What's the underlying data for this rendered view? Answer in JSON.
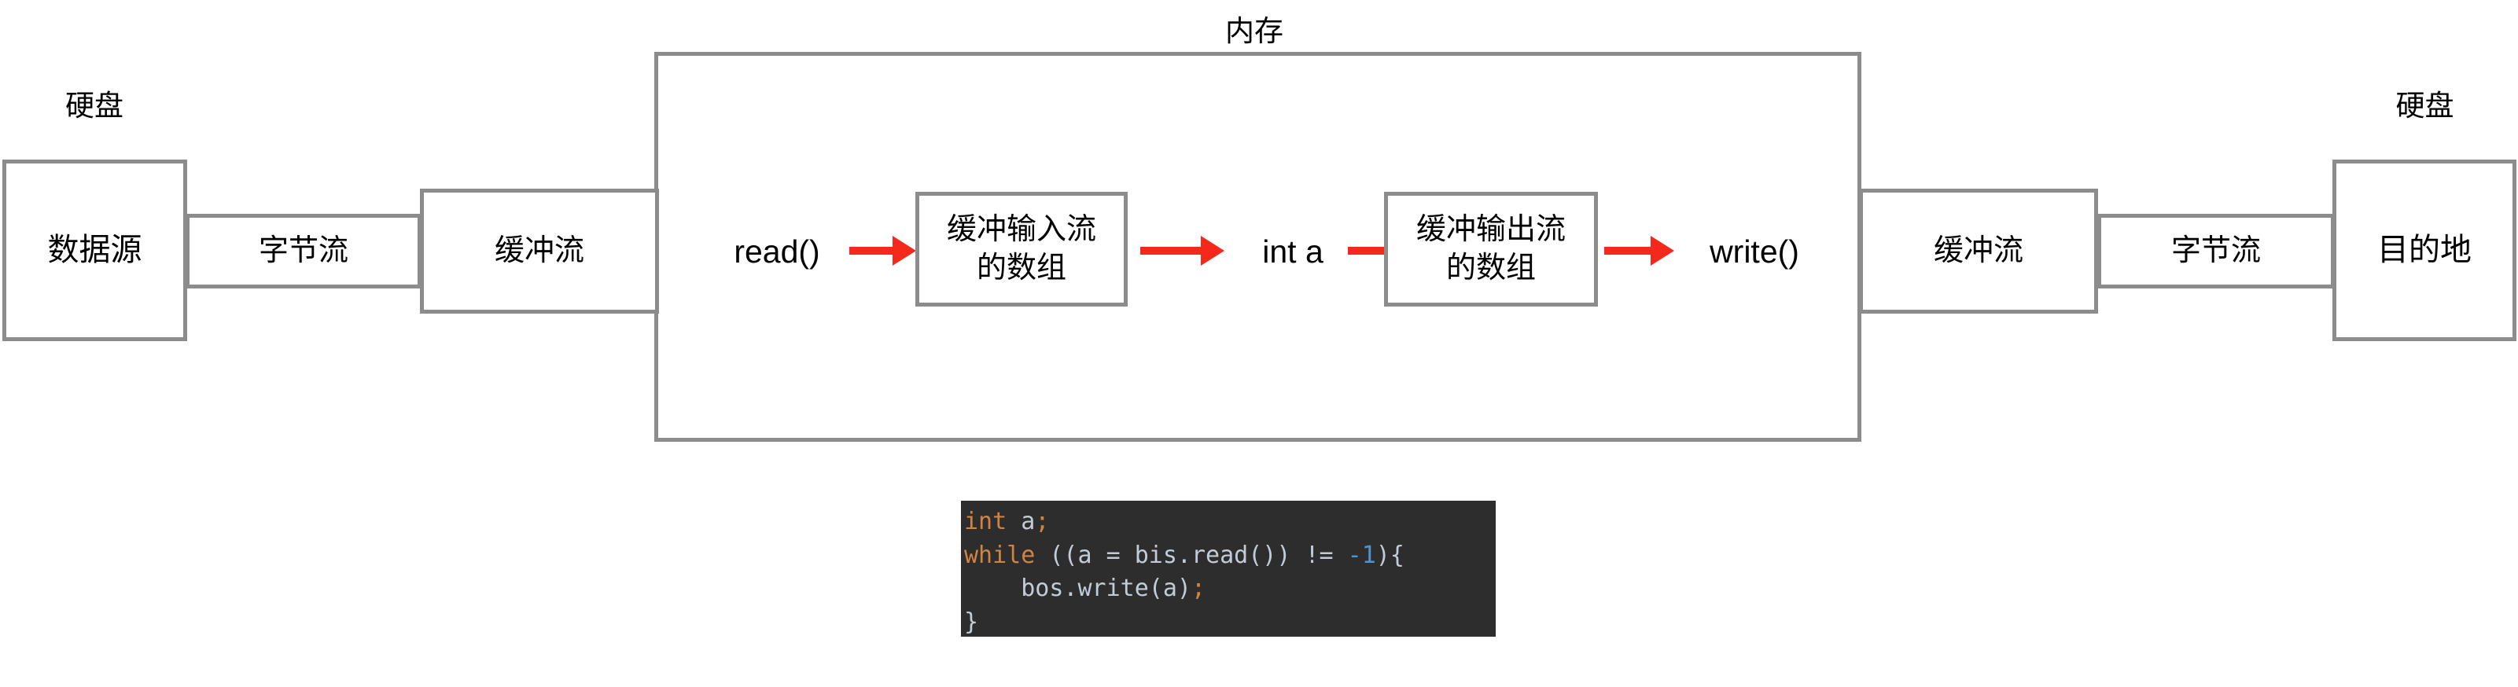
{
  "diagram": {
    "title_memory": "内存",
    "caption_left_disk": "硬盘",
    "caption_right_disk": "硬盘",
    "boxes": {
      "source": "数据源",
      "left_byte_stream": "字节流",
      "left_buffered_stream": "缓冲流",
      "buffered_input_array_line1": "缓冲输入流",
      "buffered_input_array_line2": "的数组",
      "buffered_output_array_line1": "缓冲输出流",
      "buffered_output_array_line2": "的数组",
      "right_buffered_stream": "缓冲流",
      "right_byte_stream": "字节流",
      "destination": "目的地"
    },
    "labels": {
      "read_call": "read()",
      "int_variable": "int a",
      "write_call": "write()"
    },
    "colors": {
      "box_border": "#8c8c8c",
      "arrow": "#f5291b",
      "text": "#000000",
      "code_background": "#2d2d2d",
      "code_keyword": "#d08442",
      "code_number": "#4e94ce",
      "code_text": "#c3ccd6"
    }
  },
  "code": {
    "line1": {
      "kw": "int",
      "rest": " a",
      "pun": ";"
    },
    "line2": {
      "kw": "while",
      "rest_a": " ((a = bis.read()) != ",
      "num": "-1",
      "rest_b": "){"
    },
    "line3": {
      "rest": "    bos.write(a)",
      "pun": ";"
    },
    "line4": {
      "rest": "}"
    }
  }
}
